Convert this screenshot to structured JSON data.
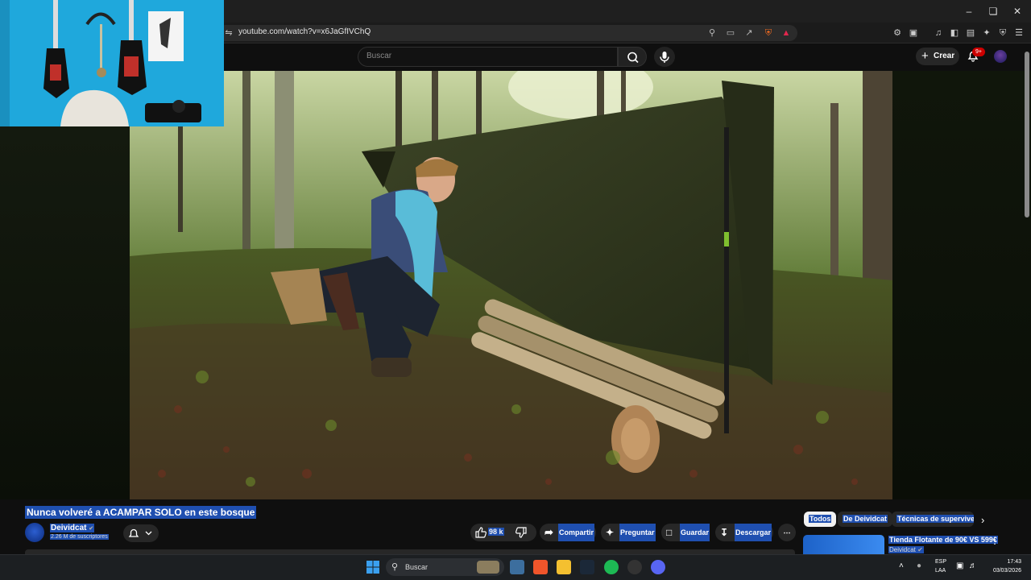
{
  "browser": {
    "url": "youtube.com/watch?v=x6JaGfIVChQ",
    "window_controls": [
      "minimize",
      "maximize",
      "close"
    ]
  },
  "youtube": {
    "search_placeholder": "Buscar",
    "create_label": "Crear",
    "notifications_badge": "9+"
  },
  "video": {
    "title": "Nunca volveré a ACAMPAR SOLO en este bosque",
    "channel": "Deividcat",
    "subscribers": "2.26 M de suscriptores",
    "likes": "98 k",
    "actions": {
      "share": "Compartir",
      "ask": "Preguntar",
      "save": "Guardar",
      "download": "Descargar"
    }
  },
  "chips": [
    "Todos",
    "De Deividcat",
    "Técnicas de supervivenc"
  ],
  "recommendation": {
    "title": "Tienda Flotante de 90€ VS 599€",
    "channel": "Deividcat"
  },
  "taskbar": {
    "search_label": "Buscar",
    "lang_line1": "ESP",
    "lang_line2": "LAA",
    "time": "17:43",
    "date": "03/03/2026"
  },
  "colors": {
    "background": "#0f0f0f",
    "selection_highlight": "#1f4fb0",
    "badge": "#cc0000"
  }
}
